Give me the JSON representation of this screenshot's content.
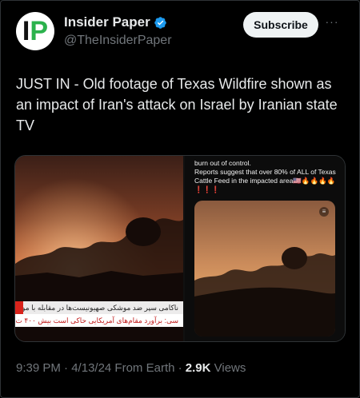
{
  "account": {
    "name": "Insider Paper",
    "handle": "@TheInsiderPaper",
    "avatar_letters": "IP",
    "verified_icon": "verified-badge-icon",
    "verified_color": "#1d9bf0"
  },
  "actions": {
    "subscribe_label": "Subscribe",
    "more_label": "···"
  },
  "tweet": {
    "text": "JUST IN - Old footage of Texas Wildfire shown as an impact of Iran's attack on Israel by Iranian state TV"
  },
  "media": {
    "left_banner_line1": "ناکامی سپر ضد موشکی صهیونیست‌ها در مقابله با موشک",
    "left_banner_line2": "سی: برآورد مقام‌های آمریکایی حاکی است بیش ۴۰۰ ت",
    "right_caption_line1": "burn out of control.",
    "right_caption_line2": "Reports suggest that over 80% of ALL of Texas Cattle Feed in the impacted area🇺🇸🔥🔥🔥🔥",
    "right_caption_line3": "❗❗❗"
  },
  "meta": {
    "time": "9:39 PM",
    "separator1": " · ",
    "date": "4/13/24",
    "source": " From Earth",
    "separator2": " · ",
    "views_count": "2.9K",
    "views_label": " Views"
  }
}
